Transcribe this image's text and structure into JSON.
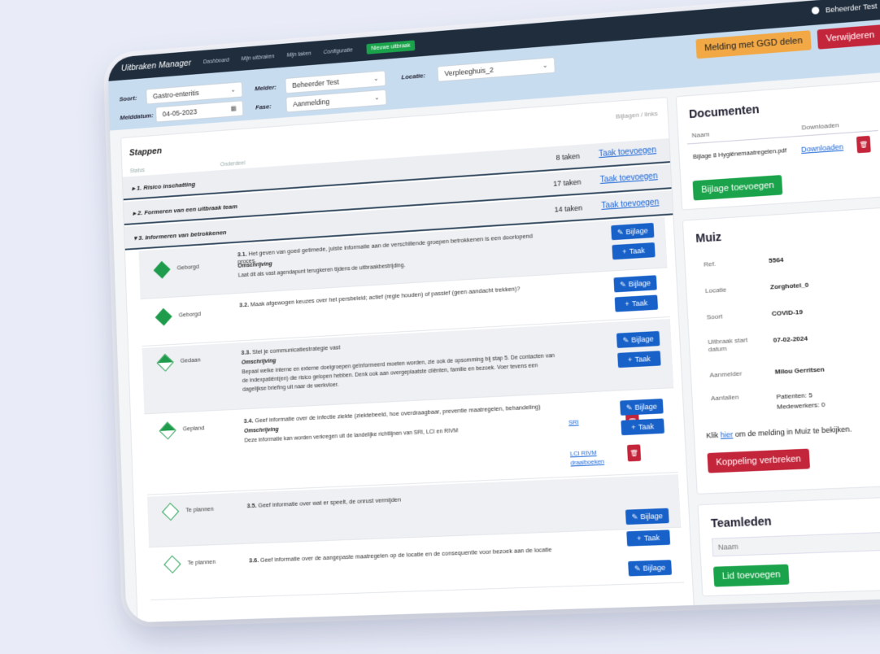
{
  "app": {
    "title": "Uitbraken Manager"
  },
  "nav": [
    "Dashboard",
    "Mijn uitbraken",
    "Mijn taken",
    "Configuratie"
  ],
  "nav_new": "Nieuwe uitbraak",
  "user": {
    "name": "Beheerder Test"
  },
  "filters": {
    "soort_label": "Soort:",
    "soort_value": "Gastro-enteritis",
    "melder_label": "Melder:",
    "melder_value": "Beheerder Test",
    "locatie_label": "Locatie:",
    "locatie_value": "Verpleeghuis_2",
    "melddatum_label": "Melddatum:",
    "melddatum_value": "04-05-2023",
    "fase_label": "Fase:",
    "fase_value": "Aanmelding"
  },
  "actions": {
    "share": "Melding met GGD delen",
    "delete": "Verwijderen"
  },
  "steps_panel": {
    "title": "Stappen",
    "hint": "Bijlagen / links",
    "col_status": "Status",
    "col_part": "Onderdeel",
    "steps": [
      {
        "title": "▸ 1. Risico inschatting",
        "count": "8 taken",
        "link": "Taak toevoegen"
      },
      {
        "title": "▸ 2. Formeren van een uitbraak team",
        "count": "17 taken",
        "link": "Taak toevoegen"
      },
      {
        "title": "▾ 3. Informeren van betrokkenen",
        "count": "14 taken",
        "link": "Taak toevoegen"
      }
    ],
    "tasks": [
      {
        "status": "Geborgd",
        "num": "3.1.",
        "title": "Het geven van goed getimede, juiste informatie aan de verschillende groepen betrokkenen is een doorlopend proces.",
        "desc_head": "Omschrijving",
        "desc": "Laat dit als vast agendapunt terugkeren tijdens de uitbraakbestrijding."
      },
      {
        "status": "Geborgd",
        "num": "3.2.",
        "title": "Maak afgewogen keuzes over het persbeleid; actief (regie houden) of passief (geen aandacht trekken)?",
        "desc_head": "",
        "desc": ""
      },
      {
        "status": "Gedaan",
        "num": "3.3.",
        "title": "Stel je communicatiestrategie vast",
        "desc_head": "Omschrijving",
        "desc": "Bepaal welke interne en externe doelgroepen geïnformeerd moeten worden, zie ook de opsomming bij stap 5. De contacten van de indexpatiënt(en) die risico gelopen hebben. Denk ook aan overgeplaatste cliënten, familie en bezoek. Voer tevens een dagelijkse briefing uit naar de werkvloer."
      },
      {
        "status": "Gepland",
        "num": "3.4.",
        "title": "Geef informatie over de infectie ziekte (ziektebeeld, hoe overdraagbaar, preventie maatregelen, behandeling)",
        "desc_head": "Omschrijving",
        "desc": "Deze informatie kan worden verkregen uit de landelijke richtlijnen van SRI, LCI en RIVM"
      },
      {
        "status": "Te plannen",
        "num": "3.5.",
        "title": "Geef informatie over wat er speelt, de onrust vermijden",
        "desc_head": "",
        "desc": ""
      },
      {
        "status": "Te plannen",
        "num": "3.6.",
        "title": "Geef informatie over de aangepaste maatregelen op de locatie en de consequentie voor bezoek aan de locatie",
        "desc_head": "",
        "desc": ""
      }
    ],
    "links": [
      "SRI",
      "LCI RIVM draaiboeken"
    ],
    "bijlage_label": "Bijlage",
    "taak_label": "Taak"
  },
  "documents": {
    "title": "Documenten",
    "col_name": "Naam",
    "col_download": "Downloaden",
    "file": "Bijlage 8 Hygiënemaatregelen.pdf",
    "download": "Downloaden",
    "add": "Bijlage toevoegen"
  },
  "muiz": {
    "title": "Muiz",
    "rows": [
      {
        "label": "Ref.",
        "value": "5564"
      },
      {
        "label": "Locatie",
        "value": "Zorghotel_0"
      },
      {
        "label": "Soort",
        "value": "COVID-19"
      },
      {
        "label": "Uitbraak start datum",
        "value": "07-02-2024"
      },
      {
        "label": "Aanmelder",
        "value": "Milou Gerritsen"
      },
      {
        "label": "Aantallen",
        "value": "Patienten: 5"
      }
    ],
    "medewerkers": "Medewerkers: 0",
    "link_pre": "Klik ",
    "link_word": "hier",
    "link_post": " om de melding in Muiz te bekijken.",
    "unlink": "Koppeling verbreken"
  },
  "team": {
    "title": "Teamleden",
    "placeholder": "Naam",
    "add": "Lid toevoegen"
  }
}
